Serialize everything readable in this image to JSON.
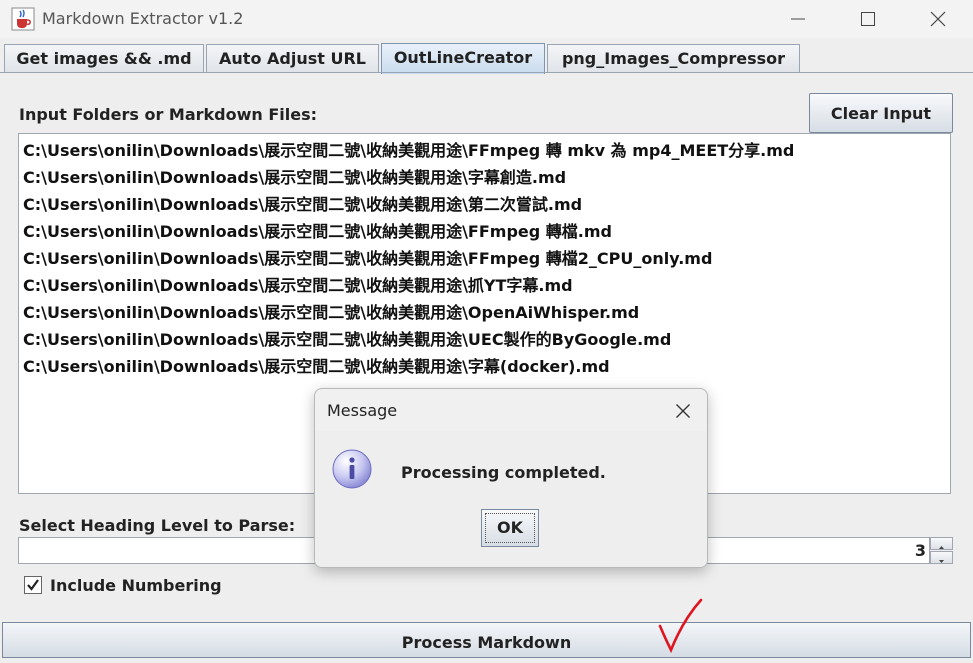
{
  "window": {
    "title": "Markdown Extractor v1.2",
    "icons": {
      "app": "java-cup-icon",
      "minimize": "minimize-icon",
      "maximize": "maximize-icon",
      "close": "close-icon"
    }
  },
  "tabs": [
    {
      "label": "Get images && .md",
      "active": false
    },
    {
      "label": "Auto Adjust URL",
      "active": false
    },
    {
      "label": "OutLineCreator",
      "active": true
    },
    {
      "label": "png_Images_Compressor",
      "active": false
    }
  ],
  "main": {
    "input_label": "Input Folders or Markdown Files:",
    "clear_button": "Clear Input",
    "files": [
      "C:\\Users\\onilin\\Downloads\\展示空間二號\\收納美觀用途\\FFmpeg 轉 mkv 為 mp4_MEET分享.md",
      "C:\\Users\\onilin\\Downloads\\展示空間二號\\收納美觀用途\\字幕創造.md",
      "C:\\Users\\onilin\\Downloads\\展示空間二號\\收納美觀用途\\第二次嘗試.md",
      "C:\\Users\\onilin\\Downloads\\展示空間二號\\收納美觀用途\\FFmpeg 轉檔.md",
      "C:\\Users\\onilin\\Downloads\\展示空間二號\\收納美觀用途\\FFmpeg 轉檔2_CPU_only.md",
      "C:\\Users\\onilin\\Downloads\\展示空間二號\\收納美觀用途\\抓YT字幕.md",
      "C:\\Users\\onilin\\Downloads\\展示空間二號\\收納美觀用途\\OpenAiWhisper.md",
      "C:\\Users\\onilin\\Downloads\\展示空間二號\\收納美觀用途\\UEC製作的ByGoogle.md",
      "C:\\Users\\onilin\\Downloads\\展示空間二號\\收納美觀用途\\字幕(docker).md"
    ],
    "heading_label": "Select Heading Level to Parse:",
    "heading_value": "3",
    "include_numbering_label": "Include Numbering",
    "include_numbering_checked": true,
    "process_button": "Process Markdown"
  },
  "dialog": {
    "title": "Message",
    "message": "Processing completed.",
    "ok_button": "OK",
    "icon": "info-icon"
  },
  "colors": {
    "active_tab": "#c9dbee",
    "info_icon": "#8f8fd8",
    "red_checkmark": "#e0141e"
  }
}
